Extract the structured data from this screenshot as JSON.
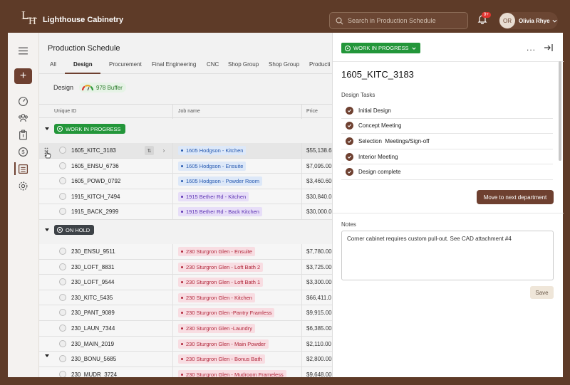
{
  "app": {
    "brand": "Lighthouse Cabinetry",
    "logo_letters": [
      "L",
      "H"
    ]
  },
  "search": {
    "placeholder": "Search in Production Schedule"
  },
  "notifications": {
    "badge": "9+"
  },
  "user": {
    "initials": "OR",
    "name": "Olivia Rhye"
  },
  "main": {
    "title": "Production Schedule",
    "tabs": [
      {
        "label": "All"
      },
      {
        "label": "Design"
      },
      {
        "label": "Procurement"
      },
      {
        "label": "Final Engineering"
      },
      {
        "label": "CNC"
      },
      {
        "label": "Shop Group"
      },
      {
        "label": "Shop Group"
      },
      {
        "label": "Producti"
      }
    ],
    "active_tab": "Design",
    "department": "Design",
    "buffer": "978 Buffer",
    "columns": {
      "uid": "Unique ID",
      "job": "Job name",
      "price": "Price"
    },
    "groups": [
      {
        "status": "WORK IN PROGRESS",
        "rows": [
          {
            "uid": "1605_KITC_3183",
            "job": "1605 Hodgson - Kitchen",
            "color": "blue",
            "price": "$55,138.6"
          },
          {
            "uid": "1605_ENSU_6736",
            "job": "1605 Hodgson - Ensuite",
            "color": "blue",
            "price": "$7,095.00"
          },
          {
            "uid": "1605_POWD_0792",
            "job": "1605 Hodgson - Powder Room",
            "color": "blue",
            "price": "$3,460.60"
          },
          {
            "uid": "1915_KITCH_7494",
            "job": "1915 Bether Rd - Kitchen",
            "color": "purple",
            "price": "$30,840.0"
          },
          {
            "uid": "1915_BACK_2999",
            "job": "1915 Bether Rd - Back Kitchen",
            "color": "purple",
            "price": "$30,000.0"
          }
        ]
      },
      {
        "status": "ON HOLD",
        "rows": [
          {
            "uid": "230_ENSU_9511",
            "job": "230 Sturgron Glen - Ensuite",
            "color": "red",
            "price": "$7,780.00"
          },
          {
            "uid": "230_LOFT_8831",
            "job": "230 Sturgron Glen - Loft Bath 2",
            "color": "red",
            "price": "$3,725.00"
          },
          {
            "uid": "230_LOFT_9544",
            "job": "230 Sturgron Glen - Loft Bath 1",
            "color": "red",
            "price": "$3,300.00"
          },
          {
            "uid": "230_KITC_5435",
            "job": "230 Sturgron Glen - Kitchen",
            "color": "red",
            "price": "$66,411.0"
          },
          {
            "uid": "230_PANT_9089",
            "job": "230 Sturgron Glen -Pantry Framless",
            "color": "red",
            "price": "$9,915.00"
          },
          {
            "uid": "230_LAUN_7344",
            "job": "230 Sturgron Glen -Laundry",
            "color": "red",
            "price": "$6,385.00"
          },
          {
            "uid": "230_MAIN_2019",
            "job": "230 Sturgron Glen - Main Powder",
            "color": "red",
            "price": "$2,110.00"
          },
          {
            "uid": "230_BONU_5685",
            "job": "230 Sturgron Glen - Bonus Bath",
            "color": "red",
            "price": "$2,800.00"
          },
          {
            "uid": "230_MUDR_3724",
            "job": "230 Sturgron Glen - Mudroom Frameless",
            "color": "red",
            "price": "$9,648.00"
          }
        ]
      }
    ]
  },
  "panel": {
    "status": "WORK IN PROGRESS",
    "job_id": "1605_KITC_3183",
    "tasks_label": "Design Tasks",
    "tasks": [
      {
        "label": "Initial Design",
        "done": true
      },
      {
        "label": "Concept Meeting",
        "done": true
      },
      {
        "label": "Selection  Meetings/Sign-off",
        "done": true
      },
      {
        "label": "Interior Meeting",
        "done": true
      },
      {
        "label": "Design complete",
        "done": true
      }
    ],
    "move_button": "Move to next department",
    "notes_label": "Notes",
    "notes_value": "Corner cabinet requires custom pull-out. See CAD attachment #4",
    "save_button": "Save",
    "more_label": "..."
  },
  "colors": {
    "brand_brown": "#6e4030",
    "topbar": "#5e3b28",
    "wip_green": "#23963a",
    "hold_dark": "#3d4247"
  }
}
